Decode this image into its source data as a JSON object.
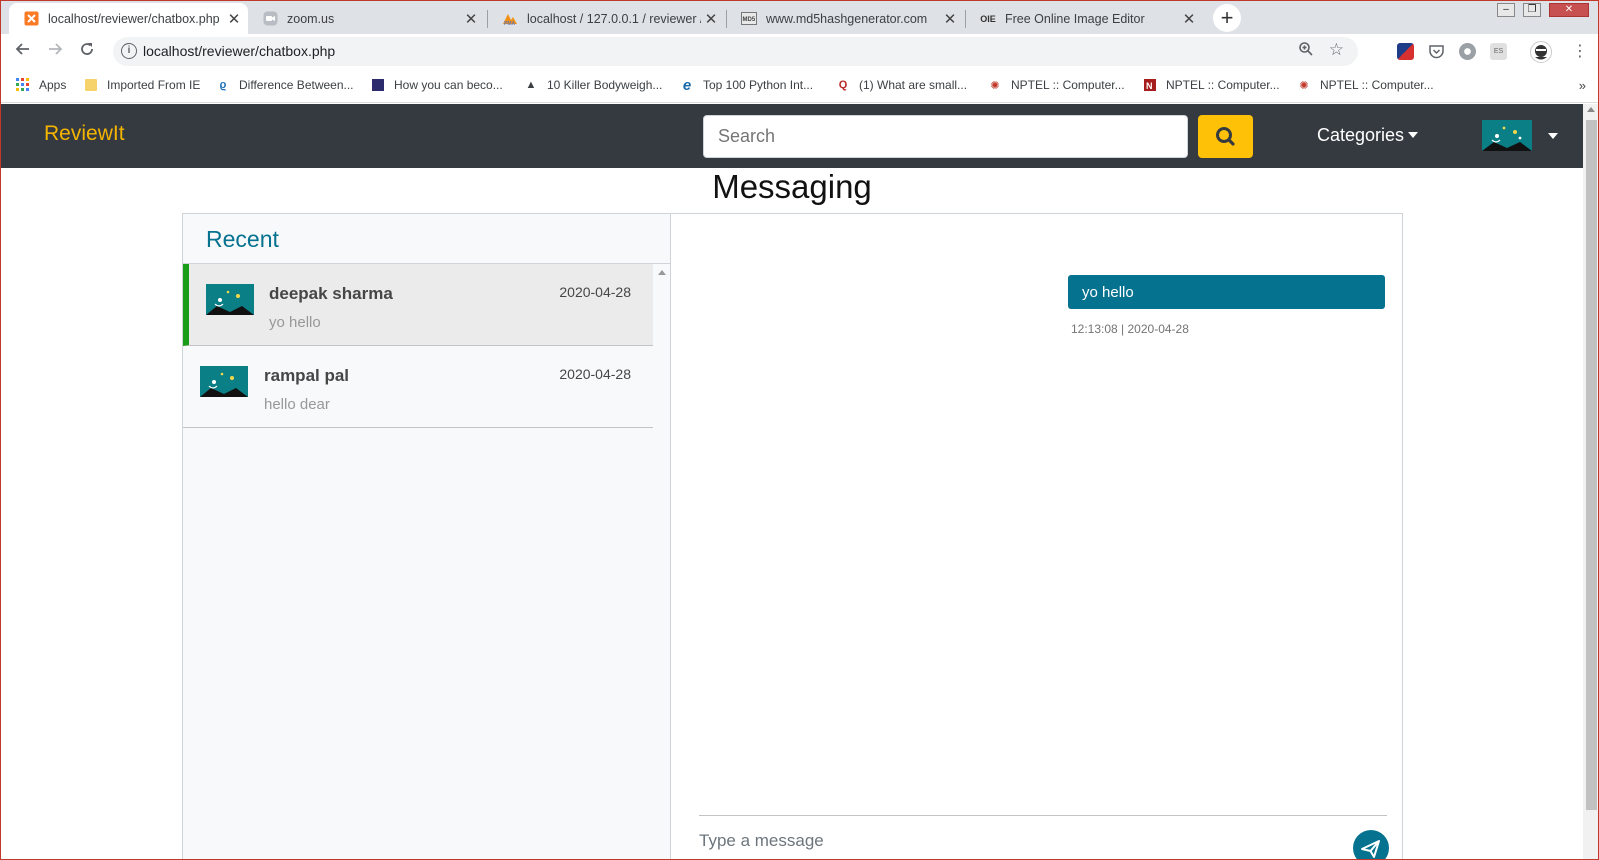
{
  "browser": {
    "tabs": [
      {
        "title": "localhost/reviewer/chatbox.php",
        "icon": "xampp-favicon-icon",
        "active": true
      },
      {
        "title": "zoom.us",
        "icon": "zoom-favicon-icon",
        "active": false
      },
      {
        "title": "localhost / 127.0.0.1 / reviewer /",
        "icon": "phpmyadmin-favicon-icon",
        "active": false
      },
      {
        "title": "www.md5hashgenerator.com",
        "icon": "md5-favicon-icon",
        "active": false
      },
      {
        "title": "Free Online Image Editor",
        "icon": "oie-favicon-icon",
        "active": false
      }
    ],
    "url": "localhost/reviewer/chatbox.php",
    "bookmarks": [
      {
        "label": "Apps",
        "icon": "apps-grid-icon"
      },
      {
        "label": "Imported From IE",
        "icon": "folder-icon"
      },
      {
        "label": "Difference Between...",
        "icon": "bookmark-favicon-icon"
      },
      {
        "label": "How you can beco...",
        "icon": "bookmark-favicon-icon"
      },
      {
        "label": "10 Killer Bodyweigh...",
        "icon": "bookmark-favicon-icon"
      },
      {
        "label": "Top 100 Python Int...",
        "icon": "bookmark-favicon-icon"
      },
      {
        "label": "(1) What are small...",
        "icon": "quora-favicon-icon"
      },
      {
        "label": "NPTEL :: Computer...",
        "icon": "nptel-favicon-icon"
      },
      {
        "label": "NPTEL :: Computer...",
        "icon": "nptel-favicon-icon"
      },
      {
        "label": "NPTEL :: Computer...",
        "icon": "nptel-favicon-icon"
      }
    ],
    "more_label": "»"
  },
  "site": {
    "brand": "ReviewIt",
    "search_placeholder": "Search",
    "categories_label": "Categories",
    "accent_color": "#ffc107",
    "navbar_color": "#343a40"
  },
  "page": {
    "title": "Messaging",
    "recent_title": "Recent"
  },
  "conversations": [
    {
      "name": "deepak sharma",
      "date": "2020-04-28",
      "preview": "yo hello",
      "active": true
    },
    {
      "name": "rampal pal",
      "date": "2020-04-28",
      "preview": "hello dear",
      "active": false
    }
  ],
  "messages": [
    {
      "text": "yo hello",
      "time": "12:13:08 | 2020-04-28",
      "outgoing": true
    }
  ],
  "composer": {
    "placeholder": "Type a message",
    "send_color": "#05728f"
  }
}
